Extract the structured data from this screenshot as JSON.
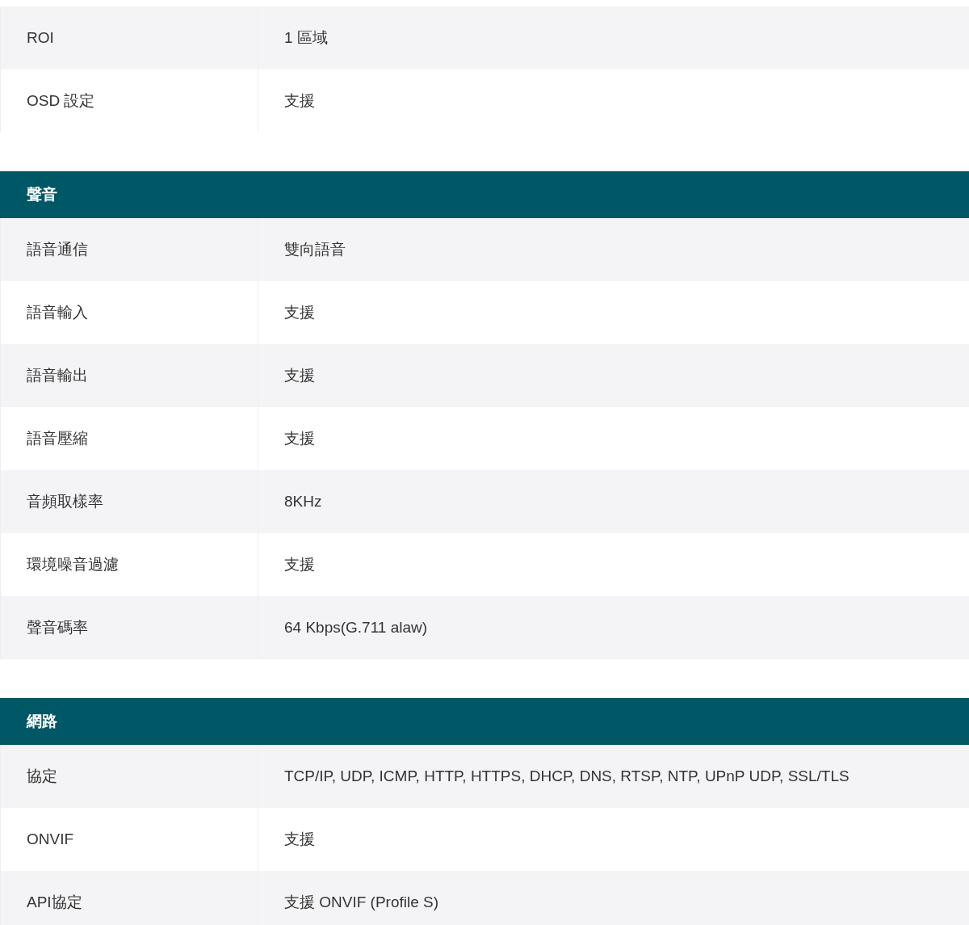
{
  "sections": [
    {
      "rows": [
        {
          "label": "ROI",
          "value": "1 區域"
        },
        {
          "label": "OSD 設定",
          "value": "支援"
        }
      ]
    },
    {
      "title": "聲音",
      "rows": [
        {
          "label": "語音通信",
          "value": "雙向語音"
        },
        {
          "label": "語音輸入",
          "value": "支援"
        },
        {
          "label": "語音輸出",
          "value": "支援"
        },
        {
          "label": "語音壓縮",
          "value": "支援"
        },
        {
          "label": "音頻取樣率",
          "value": "8KHz"
        },
        {
          "label": "環境噪音過濾",
          "value": "支援"
        },
        {
          "label": "聲音碼率",
          "value": "64 Kbps(G.711 alaw)"
        }
      ]
    },
    {
      "title": "網路",
      "rows": [
        {
          "label": "協定",
          "value": "TCP/IP, UDP, ICMP, HTTP, HTTPS, DHCP, DNS, RTSP, NTP, UPnP UDP, SSL/TLS"
        },
        {
          "label": "ONVIF",
          "value": "支援"
        },
        {
          "label": "API協定",
          "value": "支援 ONVIF (Profile S)"
        }
      ]
    }
  ]
}
